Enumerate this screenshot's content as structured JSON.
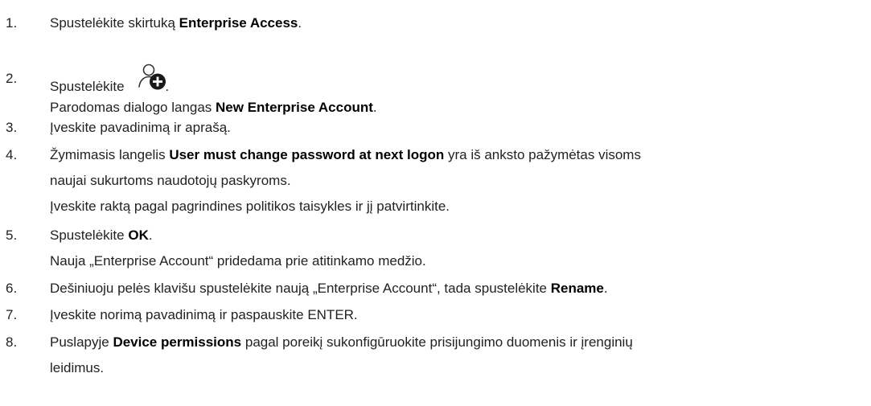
{
  "steps": [
    {
      "num": "1.",
      "parts": [
        "Spustelėkite skirtuką ",
        "Enterprise Access",
        "."
      ]
    },
    {
      "num": "2.",
      "parts": [
        "Spustelėkite",
        "."
      ],
      "icon": "user-add-icon",
      "sub": [
        "Parodomas dialogo langas ",
        "New Enterprise Account",
        "."
      ]
    },
    {
      "num": "3.",
      "text": "Įveskite pavadinimą ir aprašą."
    },
    {
      "num": "4.",
      "parts": [
        "Žymimasis langelis ",
        "User must change password at next logon",
        " yra iš anksto pažymėtas visoms"
      ],
      "line2": "naujai sukurtoms naudotojų paskyroms.",
      "line3": "Įveskite raktą pagal pagrindines politikos taisykles ir jį patvirtinkite."
    },
    {
      "num": "5.",
      "parts": [
        "Spustelėkite ",
        "OK",
        "."
      ],
      "line2": "Nauja „Enterprise Account“ pridedama prie atitinkamo medžio."
    },
    {
      "num": "6.",
      "parts": [
        "Dešiniuoju pelės klavišu spustelėkite naują „Enterprise Account“, tada spustelėkite ",
        "Rename",
        "."
      ]
    },
    {
      "num": "7.",
      "text": "Įveskite norimą pavadinimą ir paspauskite ENTER."
    },
    {
      "num": "8.",
      "parts": [
        "Puslapyje ",
        "Device permissions",
        " pagal poreikį sukonfigūruokite prisijungimo duomenis ir įrenginių"
      ],
      "line2": "leidimus."
    }
  ]
}
